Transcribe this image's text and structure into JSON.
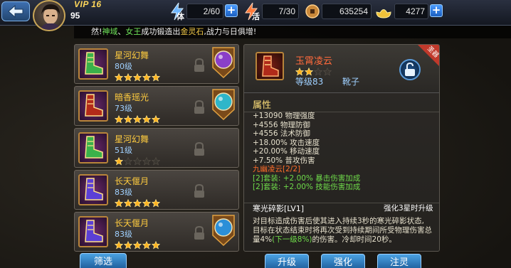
{
  "player": {
    "vip": "VIP 16",
    "level": "95"
  },
  "resources": [
    {
      "label": "体",
      "value": "2/60",
      "icon": "stamina-bolt-icon"
    },
    {
      "label": "活",
      "value": "7/30",
      "icon": "activity-bolt-icon"
    },
    {
      "label": "",
      "value": "635254",
      "icon": "copper-coin-icon"
    },
    {
      "label": "",
      "value": "4277",
      "icon": "gold-ingot-icon"
    }
  ],
  "ticker": {
    "prefix": "然!",
    "name1": "神域",
    "sep": "、",
    "name2": "女王",
    "middle": "成功锻造出",
    "item": "金灵石",
    "suffix": ",战力与日俱增!"
  },
  "equipment_list": [
    {
      "name": "星河幻舞",
      "level": "80级",
      "stars": 5,
      "max_stars": 5,
      "has_gem": true,
      "gem_color": "#8a3fc8"
    },
    {
      "name": "暗香瑶光",
      "level": "73级",
      "stars": 5,
      "max_stars": 5,
      "has_gem": true,
      "gem_color": "#2fb6c9"
    },
    {
      "name": "星河幻舞",
      "level": "51级",
      "stars": 1,
      "max_stars": 5,
      "has_gem": false,
      "gem_color": ""
    },
    {
      "name": "长天偃月",
      "level": "83级",
      "stars": 5,
      "max_stars": 5,
      "has_gem": false,
      "gem_color": ""
    },
    {
      "name": "长天偃月",
      "level": "83级",
      "stars": 5,
      "max_stars": 5,
      "has_gem": true,
      "gem_color": "#2b8fd8"
    }
  ],
  "filter_label": "筛选",
  "detail": {
    "name": "玉霄凌云",
    "stars": 2,
    "max_stars": 4,
    "level": "等级83",
    "type": "靴子",
    "badge": "圣器",
    "attr_title": "属性",
    "attributes": [
      "+13090 物理强度",
      "+4556 物理防御",
      "+4556 法术防御",
      "+18.00% 攻击速度",
      "+20.00% 移动速度",
      "+7.50% 普攻伤害"
    ],
    "set_name": "九幽凌云[2/2]",
    "set_bonuses": [
      "[2]套装: +2.00% 暴击伤害加成",
      "[2]套装: +2.00% 技能伤害加成"
    ],
    "skill_name": "寒光碎影[LV1]",
    "skill_note": "强化3星时升级",
    "skill_desc_1": "对目标造成伤害后使其进入持续3秒的寒光碎影状态,",
    "skill_desc_2": "目标在状态结束时将再次受到持续期间所受物理伤害总",
    "skill_desc_3a": "量4%",
    "skill_desc_3b": "(下一级8%)",
    "skill_desc_3c": "的伤害。冷却时间20秒。"
  },
  "actions": {
    "upgrade": "升级",
    "enhance": "强化",
    "infuse": "注灵"
  }
}
